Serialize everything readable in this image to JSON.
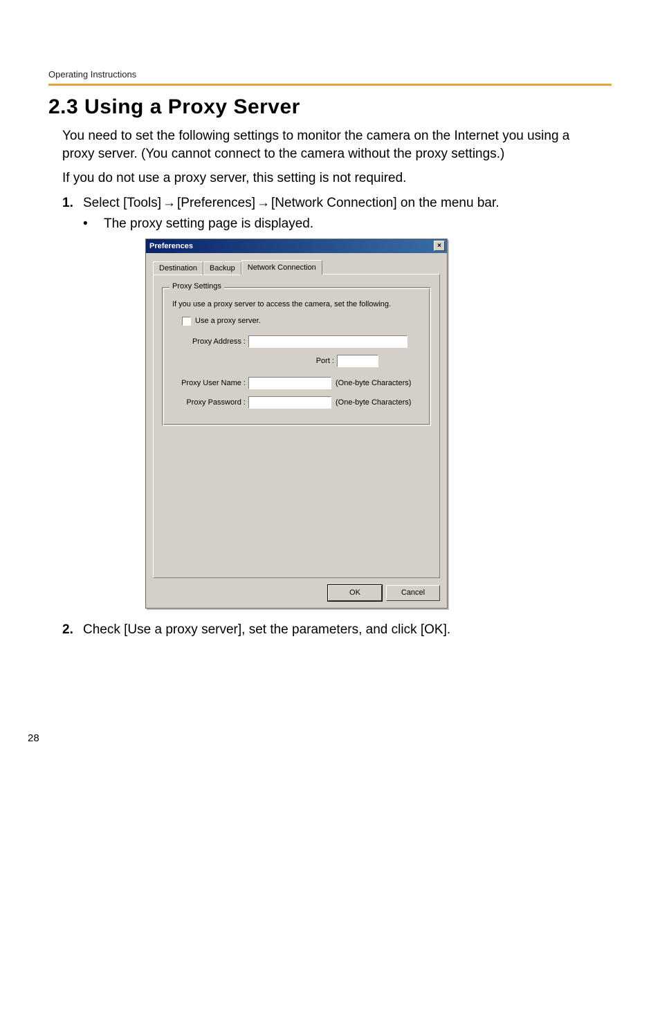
{
  "running_head": "Operating Instructions",
  "section_title": "2.3   Using a Proxy Server",
  "para1": "You need to set the following settings to monitor the camera on the Internet you using a proxy server. (You cannot connect to the camera without the proxy settings.)",
  "para2": "If you do not use a proxy server, this setting is not required.",
  "steps": {
    "s1_num": "1.",
    "s1_pre": "Select [Tools]",
    "s1_mid1": "[Preferences]",
    "s1_mid2": "[Network Connection] on the menu bar.",
    "s1_bullet": "The proxy setting page is displayed.",
    "s2_num": "2.",
    "s2_text": "Check [Use a proxy server], set the parameters, and click [OK]."
  },
  "dialog": {
    "title": "Preferences",
    "tabs": {
      "destination": "Destination",
      "backup": "Backup",
      "network": "Network Connection"
    },
    "group": {
      "legend": "Proxy Settings",
      "desc": "If you use a proxy server to access the camera, set the following.",
      "checkbox_label": "Use a proxy server.",
      "proxy_address_label": "Proxy Address :",
      "port_label": "Port :",
      "user_label": "Proxy User Name :",
      "pass_label": "Proxy Password :",
      "hint": "(One-byte Characters)"
    },
    "buttons": {
      "ok": "OK",
      "cancel": "Cancel"
    }
  },
  "page_number": "28"
}
